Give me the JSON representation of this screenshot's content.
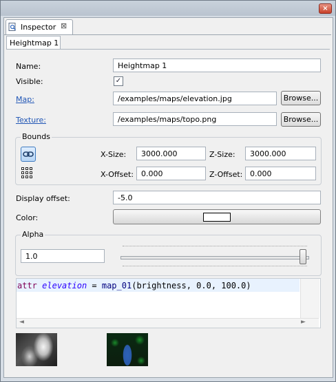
{
  "window": {
    "close_glyph": "×"
  },
  "view_tab": {
    "label": "Inspector",
    "icon": "inspector-icon",
    "close_glyph": "⊠"
  },
  "inner_tab": {
    "label": "Heightmap 1"
  },
  "fields": {
    "name": {
      "label": "Name:",
      "value": "Heightmap 1"
    },
    "visible": {
      "label": "Visible:",
      "checked": true,
      "check_glyph": "✓"
    },
    "map": {
      "label": "Map:",
      "value": "/examples/maps/elevation.jpg",
      "browse": "Browse..."
    },
    "texture": {
      "label": "Texture:",
      "value": "/examples/maps/topo.png",
      "browse": "Browse..."
    }
  },
  "bounds": {
    "title": "Bounds",
    "link_icon": "chain-link-icon",
    "grid_icon": "grid-points-icon",
    "x_size": {
      "label": "X-Size:",
      "value": "3000.000"
    },
    "z_size": {
      "label": "Z-Size:",
      "value": "3000.000"
    },
    "x_offset": {
      "label": "X-Offset:",
      "value": "0.000"
    },
    "z_offset": {
      "label": "Z-Offset:",
      "value": "0.000"
    }
  },
  "display_offset": {
    "label": "Display offset:",
    "value": "-5.0"
  },
  "color": {
    "label": "Color:",
    "value": "#ffffff"
  },
  "alpha": {
    "title": "Alpha",
    "value": "1.0",
    "slider_level": 1.0
  },
  "code": {
    "kw": "attr",
    "var": "elevation",
    "eq": " = ",
    "fn": "map_01",
    "args": "(brightness, 0.0, 100.0)"
  },
  "scroll": {
    "left_glyph": "◄",
    "right_glyph": "►"
  }
}
